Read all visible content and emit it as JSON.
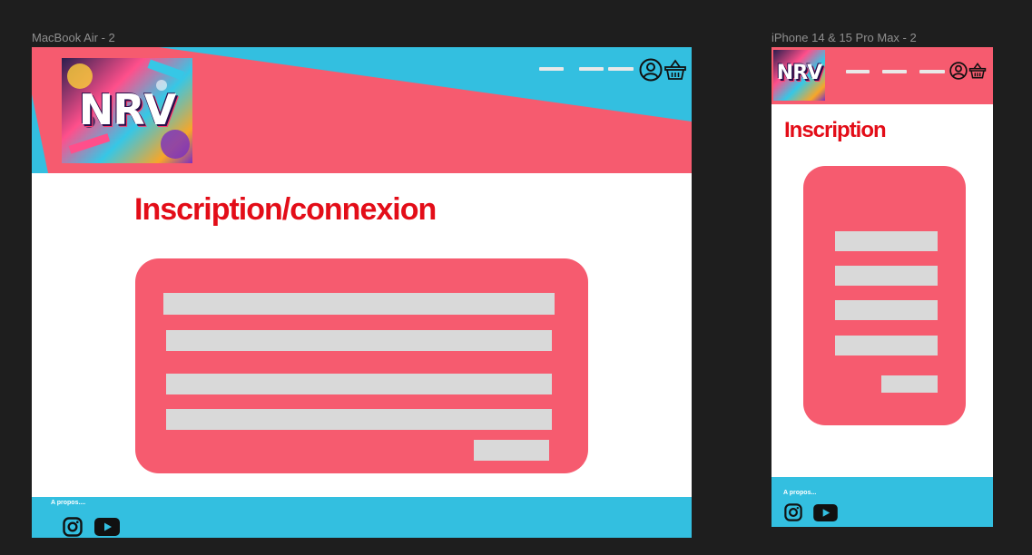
{
  "frames": {
    "desktop": {
      "label": "MacBook Air - 2",
      "title": "Inscription/connexion",
      "footer_text": "A propos....",
      "logo_text": "NRV"
    },
    "mobile": {
      "label": "iPhone 14 & 15 Pro Max - 2",
      "title": "Inscription",
      "footer_text": "A propos...",
      "logo_text": "NRV"
    }
  },
  "colors": {
    "canvas": "#1e1e1e",
    "header_pink": "#f65b6f",
    "header_cyan": "#33bfe0",
    "title_red": "#e30d18",
    "field_gray": "#d9d9d9",
    "footer_cyan": "#33bfe0"
  },
  "icons": [
    "user-circle-icon",
    "basket-icon",
    "instagram-icon",
    "youtube-icon"
  ]
}
